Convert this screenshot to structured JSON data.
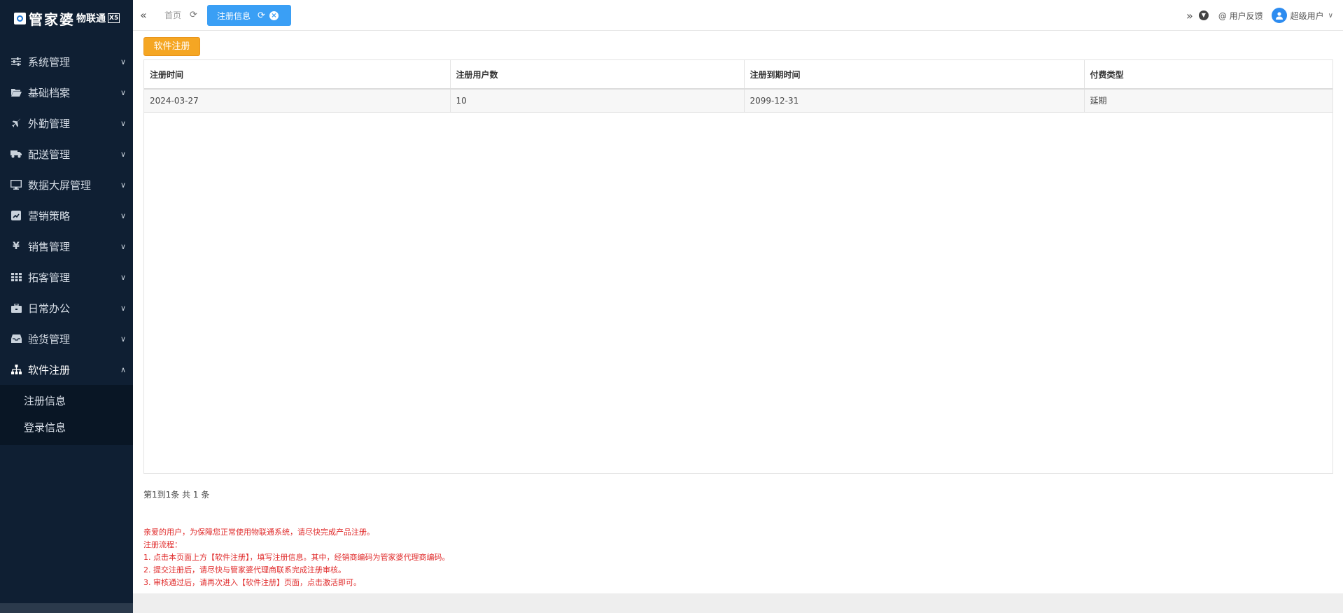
{
  "brand": {
    "name": "管家婆",
    "product": "物联通",
    "edition": "X5"
  },
  "menu": [
    {
      "label": "系统管理",
      "icon": "sliders-icon",
      "chevron": "chevron-down"
    },
    {
      "label": "基础档案",
      "icon": "folder-open-icon",
      "chevron": "chevron-down"
    },
    {
      "label": "外勤管理",
      "icon": "plane-icon",
      "chevron": "chevron-down"
    },
    {
      "label": "配送管理",
      "icon": "truck-icon",
      "chevron": "chevron-down"
    },
    {
      "label": "数据大屏管理",
      "icon": "monitor-icon",
      "chevron": "chevron-down"
    },
    {
      "label": "营销策略",
      "icon": "chart-square-icon",
      "chevron": "chevron-down"
    },
    {
      "label": "销售管理",
      "icon": "yen-icon",
      "chevron": "chevron-down"
    },
    {
      "label": "拓客管理",
      "icon": "grid-icon",
      "chevron": "chevron-down"
    },
    {
      "label": "日常办公",
      "icon": "briefcase-icon",
      "chevron": "chevron-down"
    },
    {
      "label": "验货管理",
      "icon": "inbox-icon",
      "chevron": "chevron-down"
    },
    {
      "label": "软件注册",
      "icon": "sitemap-icon",
      "chevron": "chevron-up",
      "active": true
    }
  ],
  "submenu": [
    "注册信息",
    "登录信息"
  ],
  "tabs": {
    "home": "首页",
    "active": "注册信息"
  },
  "header": {
    "feedback": "@ 用户反馈",
    "user": "超级用户"
  },
  "toolbar": {
    "register_button": "软件注册"
  },
  "table": {
    "columns": [
      "注册时间",
      "注册用户数",
      "注册到期时间",
      "付费类型"
    ],
    "rows": [
      [
        "2024-03-27",
        "10",
        "2099-12-31",
        "延期"
      ]
    ]
  },
  "pagination": "第1到1条 共 1 条",
  "notice": [
    "亲爱的用户，为保障您正常使用物联通系统，请尽快完成产品注册。",
    "注册流程：",
    "1. 点击本页面上方【软件注册】，填写注册信息。其中，经销商编码为管家婆代理商编码。",
    "2. 提交注册后，请尽快与管家婆代理商联系完成注册审核。",
    "3. 审核通过后，请再次进入【软件注册】页面，点击激活即可。"
  ],
  "colors": {
    "sidebar": "#0f1f33",
    "tab_active": "#3a9ff5",
    "button": "#f5a623",
    "notice": "#e02b2b"
  }
}
